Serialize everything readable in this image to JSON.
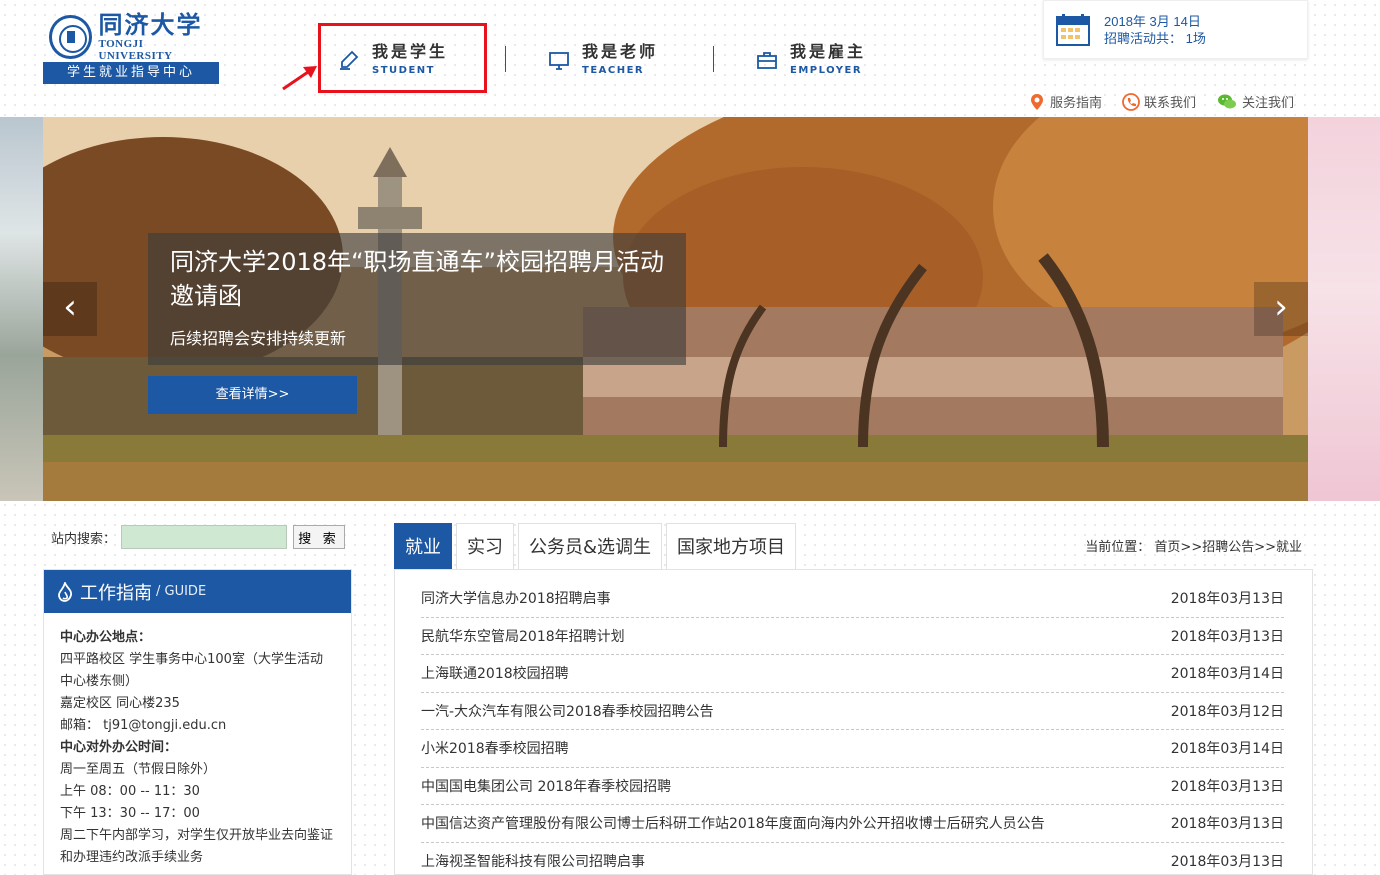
{
  "logo": {
    "cn": "同济大学",
    "en": "TONGJI UNIVERSITY",
    "subtitle": "学生就业指导中心"
  },
  "nav": [
    {
      "cn": "我是学生",
      "en": "STUDENT",
      "icon": "pen-icon"
    },
    {
      "cn": "我是老师",
      "en": "TEACHER",
      "icon": "monitor-icon"
    },
    {
      "cn": "我是雇主",
      "en": "EMPLOYER",
      "icon": "briefcase-icon"
    }
  ],
  "date_card": {
    "date": "2018年 3月 14日",
    "activity": "招聘活动共： 1场"
  },
  "service_links": [
    {
      "label": "服务指南",
      "icon": "location-pin-icon"
    },
    {
      "label": "联系我们",
      "icon": "phone-icon"
    },
    {
      "label": "关注我们",
      "icon": "wechat-icon"
    }
  ],
  "banner": {
    "title": "同济大学2018年“职场直通车”校园招聘月活动邀请函",
    "subtitle": "后续招聘会安排持续更新",
    "button": "查看详情>>",
    "prev": "‹",
    "next": "›"
  },
  "search": {
    "label": "站内搜索：",
    "value": "",
    "button": "搜 索"
  },
  "guide": {
    "title": "工作指南",
    "en": "/ GUIDE",
    "lines": [
      {
        "text": "中心办公地点：",
        "bold": true
      },
      {
        "text": "四平路校区  学生事务中心100室（大学生活动中心楼东侧）",
        "bold": false
      },
      {
        "text": "嘉定校区  同心楼235",
        "bold": false
      },
      {
        "text": "邮箱： tj91@tongji.edu.cn",
        "bold": false
      },
      {
        "text": "中心对外办公时间：",
        "bold": true
      },
      {
        "text": "周一至周五（节假日除外）",
        "bold": false
      },
      {
        "text": "上午 08：00 -- 11：30",
        "bold": false
      },
      {
        "text": "下午 13：30 -- 17：00",
        "bold": false
      },
      {
        "text": "周二下午内部学习，对学生仅开放毕业去向鉴证和办理违约改派手续业务",
        "bold": false
      }
    ]
  },
  "tabs": [
    "就业",
    "实习",
    "公务员&选调生",
    "国家地方项目"
  ],
  "active_tab": 0,
  "breadcrumb": "当前位置： 首页>>招聘公告>>就业",
  "list": [
    {
      "title": "同济大学信息办2018招聘启事",
      "date": "2018年03月13日"
    },
    {
      "title": "民航华东空管局2018年招聘计划",
      "date": "2018年03月13日"
    },
    {
      "title": "上海联通2018校园招聘",
      "date": "2018年03月14日"
    },
    {
      "title": "一汽-大众汽车有限公司2018春季校园招聘公告",
      "date": "2018年03月12日"
    },
    {
      "title": "小米2018春季校园招聘",
      "date": "2018年03月14日"
    },
    {
      "title": "中国国电集团公司 2018年春季校园招聘",
      "date": "2018年03月13日"
    },
    {
      "title": "中国信达资产管理股份有限公司博士后科研工作站2018年度面向海内外公开招收博士后研究人员公告",
      "date": "2018年03月13日"
    },
    {
      "title": "上海视圣智能科技有限公司招聘启事",
      "date": "2018年03月13日"
    }
  ],
  "colors": {
    "brand": "#1c58a3",
    "highlight": "#e8121c"
  }
}
